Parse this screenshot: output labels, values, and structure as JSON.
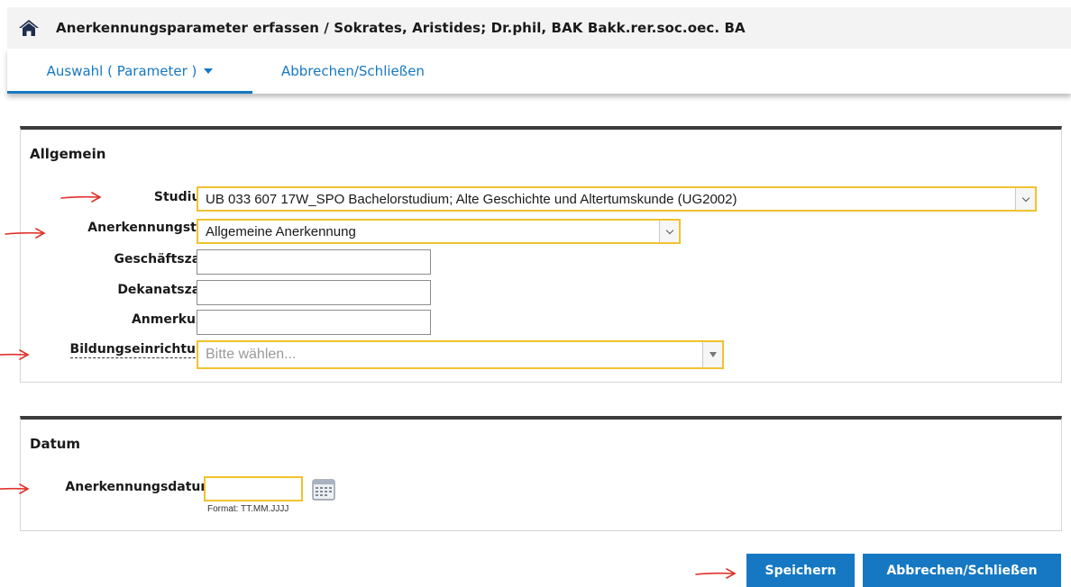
{
  "header": {
    "title": "Anerkennungsparameter erfassen  / Sokrates, Aristides; Dr.phil, BAK Bakk.rer.soc.oec. BA",
    "home_icon": "home-icon"
  },
  "tabs": [
    {
      "label": "Auswahl ( Parameter )",
      "active": true
    },
    {
      "label": "Abbrechen/Schließen",
      "active": false
    }
  ],
  "allgemein": {
    "title": "Allgemein",
    "studium": {
      "label": "Studium",
      "value": "UB 033 607 17W_SPO Bachelorstudium; Alte Geschichte und Altertumskunde (UG2002)"
    },
    "anerkennungstyp": {
      "label": "Anerkennungstyp",
      "value": "Allgemeine Anerkennung"
    },
    "geschaeftszahl": {
      "label": "Geschäftszahl",
      "value": ""
    },
    "dekanatszahl": {
      "label": "Dekanatszahl",
      "value": ""
    },
    "anmerkung": {
      "label": "Anmerkung",
      "value": ""
    },
    "bildungseinrichtung": {
      "label": "Bildungseinrichtung",
      "placeholder": "Bitte wählen..."
    }
  },
  "datum": {
    "title": "Datum",
    "anerkennungsdatum": {
      "label": "Anerkennungsdatum",
      "value": "",
      "format_hint": "Format: TT.MM.JJJJ"
    }
  },
  "buttons": {
    "save_label": "Speichern",
    "cancel_label": "Abbrechen/Schließen"
  },
  "colors": {
    "accent": "#1678c2",
    "required_border": "#f0c230",
    "annotation_arrow": "#e0322b"
  }
}
